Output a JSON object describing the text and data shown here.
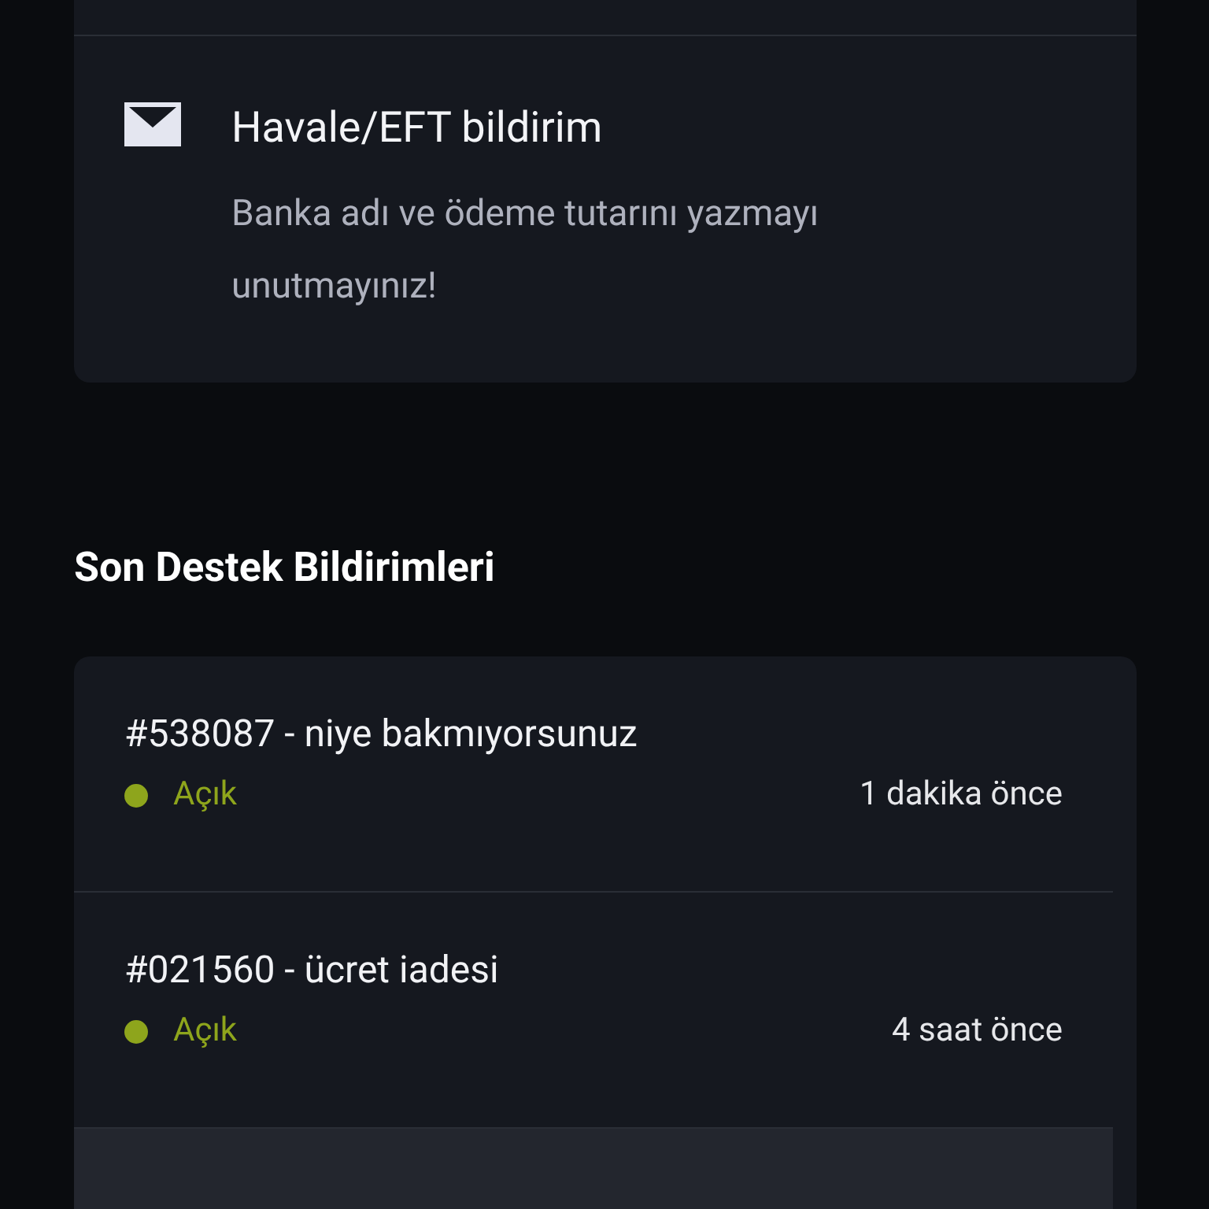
{
  "notice": {
    "title": "Havale/EFT bildirim",
    "text": "Banka adı ve ödeme tutarını yazmayı unutmayınız!"
  },
  "tickets_section": {
    "heading": "Son Destek Bildirimleri",
    "tickets": [
      {
        "title": "#538087 - niye bakmıyorsunuz",
        "status": "Açık",
        "color": "#8ea51c",
        "time": "1 dakika önce",
        "highlighted": false
      },
      {
        "title": "#021560 - ücret iadesi",
        "status": "Açık",
        "color": "#8ea51c",
        "time": "4 saat önce",
        "highlighted": false
      },
      {
        "highlighted": true
      }
    ]
  }
}
